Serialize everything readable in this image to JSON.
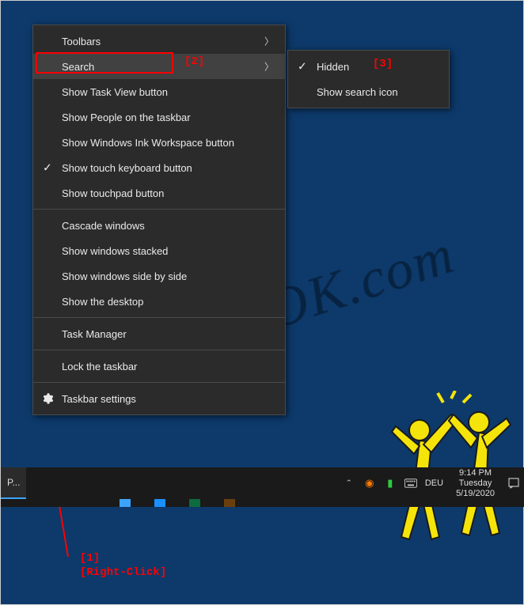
{
  "context_menu": {
    "items": [
      {
        "label": "Toolbars",
        "has_submenu": true,
        "checked": false
      },
      {
        "label": "Search",
        "has_submenu": true,
        "checked": false,
        "hovered": true
      },
      {
        "label": "Show Task View button",
        "has_submenu": false,
        "checked": false
      },
      {
        "label": "Show People on the taskbar",
        "has_submenu": false,
        "checked": false
      },
      {
        "label": "Show Windows Ink Workspace button",
        "has_submenu": false,
        "checked": false
      },
      {
        "label": "Show touch keyboard button",
        "has_submenu": false,
        "checked": true
      },
      {
        "label": "Show touchpad button",
        "has_submenu": false,
        "checked": false
      },
      {
        "sep": true
      },
      {
        "label": "Cascade windows",
        "has_submenu": false,
        "checked": false
      },
      {
        "label": "Show windows stacked",
        "has_submenu": false,
        "checked": false
      },
      {
        "label": "Show windows side by side",
        "has_submenu": false,
        "checked": false
      },
      {
        "label": "Show the desktop",
        "has_submenu": false,
        "checked": false
      },
      {
        "sep": true
      },
      {
        "label": "Task Manager",
        "has_submenu": false,
        "checked": false
      },
      {
        "sep": true
      },
      {
        "label": "Lock the taskbar",
        "has_submenu": false,
        "checked": false
      },
      {
        "sep": true
      },
      {
        "label": "Taskbar settings",
        "has_submenu": false,
        "checked": false,
        "icon": "gear"
      }
    ]
  },
  "submenu": {
    "items": [
      {
        "label": "Hidden",
        "checked": true
      },
      {
        "label": "Show search icon",
        "checked": false
      }
    ]
  },
  "annotations": {
    "a1": "[1]",
    "a1_text": "[Right-Click]",
    "a2": "[2]",
    "a3": "[3]"
  },
  "taskbar": {
    "app_label": "P...",
    "lang": "DEU",
    "clock": {
      "time": "9:14 PM",
      "day": "Tuesday",
      "date": "5/19/2020"
    }
  },
  "watermark": "SoftwareOK.com"
}
